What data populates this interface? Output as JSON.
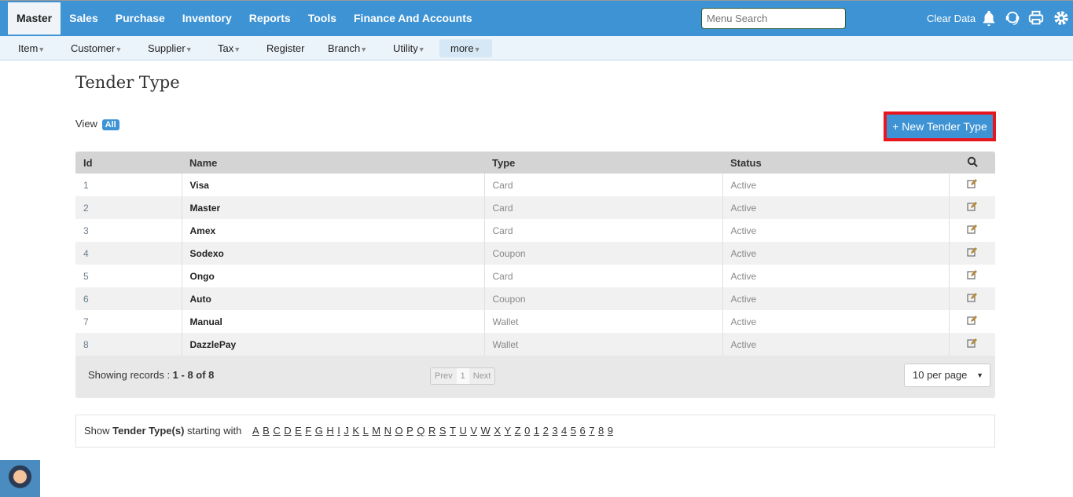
{
  "topnav": {
    "items": [
      "Master",
      "Sales",
      "Purchase",
      "Inventory",
      "Reports",
      "Tools",
      "Finance And Accounts"
    ],
    "active": "Master"
  },
  "search": {
    "placeholder": "Menu Search"
  },
  "header": {
    "clear_data": "Clear Data",
    "icons": [
      "bell-icon",
      "support-headset-icon",
      "printer-icon",
      "gear-icon"
    ]
  },
  "subnav": {
    "items": [
      {
        "label": "Item",
        "caret": true
      },
      {
        "label": "Customer",
        "caret": true
      },
      {
        "label": "Supplier",
        "caret": true
      },
      {
        "label": "Tax",
        "caret": true
      },
      {
        "label": "Register",
        "caret": false
      },
      {
        "label": "Branch",
        "caret": true
      },
      {
        "label": "Utility",
        "caret": true
      },
      {
        "label": "more",
        "caret": true
      }
    ]
  },
  "page": {
    "title": "Tender Type",
    "view_label": "View",
    "view_badge": "All",
    "new_button": "+ New Tender Type"
  },
  "table": {
    "columns": [
      "Id",
      "Name",
      "Type",
      "Status"
    ],
    "rows": [
      {
        "id": "1",
        "name": "Visa",
        "type": "Card",
        "status": "Active"
      },
      {
        "id": "2",
        "name": "Master",
        "type": "Card",
        "status": "Active"
      },
      {
        "id": "3",
        "name": "Amex",
        "type": "Card",
        "status": "Active"
      },
      {
        "id": "4",
        "name": "Sodexo",
        "type": "Coupon",
        "status": "Active"
      },
      {
        "id": "5",
        "name": "Ongo",
        "type": "Card",
        "status": "Active"
      },
      {
        "id": "6",
        "name": "Auto",
        "type": "Coupon",
        "status": "Active"
      },
      {
        "id": "7",
        "name": "Manual",
        "type": "Wallet",
        "status": "Active"
      },
      {
        "id": "8",
        "name": "DazzlePay",
        "type": "Wallet",
        "status": "Active"
      }
    ]
  },
  "footer": {
    "showing_label": "Showing records : ",
    "showing_range": "1 - 8 of 8",
    "prev": "Prev",
    "page": "1",
    "next": "Next",
    "per_page": "10 per page"
  },
  "alpha": {
    "prefix": "Show ",
    "entity": "Tender Type(s)",
    "suffix": " starting with ",
    "letters": [
      "A",
      "B",
      "C",
      "D",
      "E",
      "F",
      "G",
      "H",
      "I",
      "J",
      "K",
      "L",
      "M",
      "N",
      "O",
      "P",
      "Q",
      "R",
      "S",
      "T",
      "U",
      "V",
      "W",
      "X",
      "Y",
      "Z",
      "0",
      "1",
      "2",
      "3",
      "4",
      "5",
      "6",
      "7",
      "8",
      "9"
    ]
  },
  "colors": {
    "brand": "#3d93d4",
    "highlight": "#e8171f"
  }
}
